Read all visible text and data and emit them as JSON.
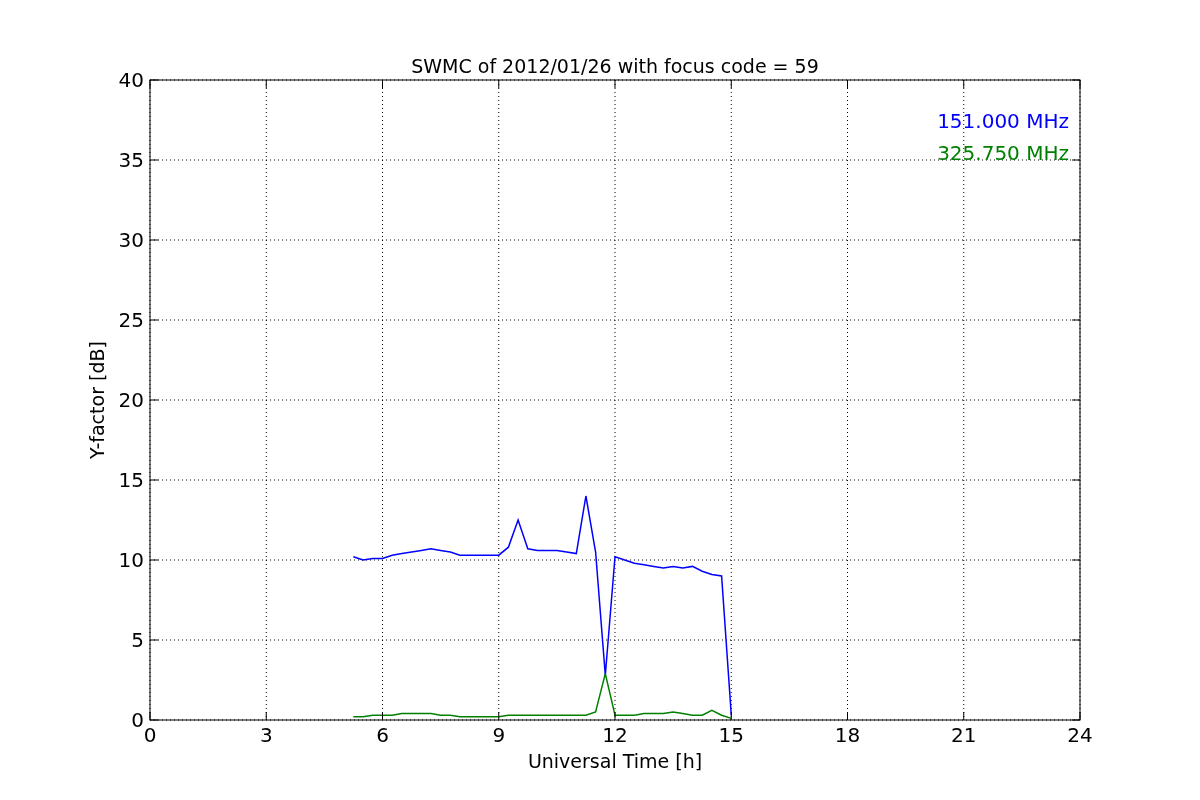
{
  "figure": {
    "chart_data": {
      "type": "line",
      "title": "SWMC of 2012/01/26 with focus code = 59",
      "xlabel": "Universal Time [h]",
      "ylabel": "Y-factor [dB]",
      "x": [
        5.25,
        5.5,
        5.75,
        6.0,
        6.25,
        6.5,
        6.75,
        7.0,
        7.25,
        7.5,
        7.75,
        8.0,
        9.0,
        9.25,
        9.5,
        9.75,
        10.0,
        10.25,
        10.5,
        10.75,
        11.0,
        11.25,
        11.5,
        11.75,
        12.0,
        12.25,
        12.5,
        12.75,
        13.0,
        13.25,
        13.5,
        13.75,
        14.0,
        14.25,
        14.5,
        14.75,
        15.0
      ],
      "series": [
        {
          "name": "151.000 MHz",
          "color": "#0000ff",
          "values": [
            10.2,
            10.0,
            10.1,
            10.1,
            10.3,
            10.4,
            10.5,
            10.6,
            10.7,
            10.6,
            10.5,
            10.3,
            10.3,
            10.8,
            12.5,
            10.7,
            10.6,
            10.6,
            10.6,
            10.5,
            10.4,
            14.0,
            10.5,
            2.8,
            10.2,
            10.0,
            9.8,
            9.7,
            9.6,
            9.5,
            9.6,
            9.5,
            9.6,
            9.3,
            9.1,
            9.0,
            0.3
          ]
        },
        {
          "name": "325.750 MHz",
          "color": "#008000",
          "values": [
            0.2,
            0.2,
            0.3,
            0.3,
            0.3,
            0.4,
            0.4,
            0.4,
            0.4,
            0.3,
            0.3,
            0.2,
            0.2,
            0.3,
            0.3,
            0.3,
            0.3,
            0.3,
            0.3,
            0.3,
            0.3,
            0.3,
            0.5,
            2.9,
            0.3,
            0.3,
            0.3,
            0.4,
            0.4,
            0.4,
            0.5,
            0.4,
            0.3,
            0.3,
            0.6,
            0.3,
            0.1
          ]
        }
      ],
      "grid": true,
      "xlim": [
        0,
        24
      ],
      "ylim": [
        0,
        40
      ],
      "xticks": [
        0,
        3,
        6,
        9,
        12,
        15,
        18,
        21,
        24
      ],
      "yticks": [
        0,
        5,
        10,
        15,
        20,
        25,
        30,
        35,
        40
      ]
    }
  }
}
